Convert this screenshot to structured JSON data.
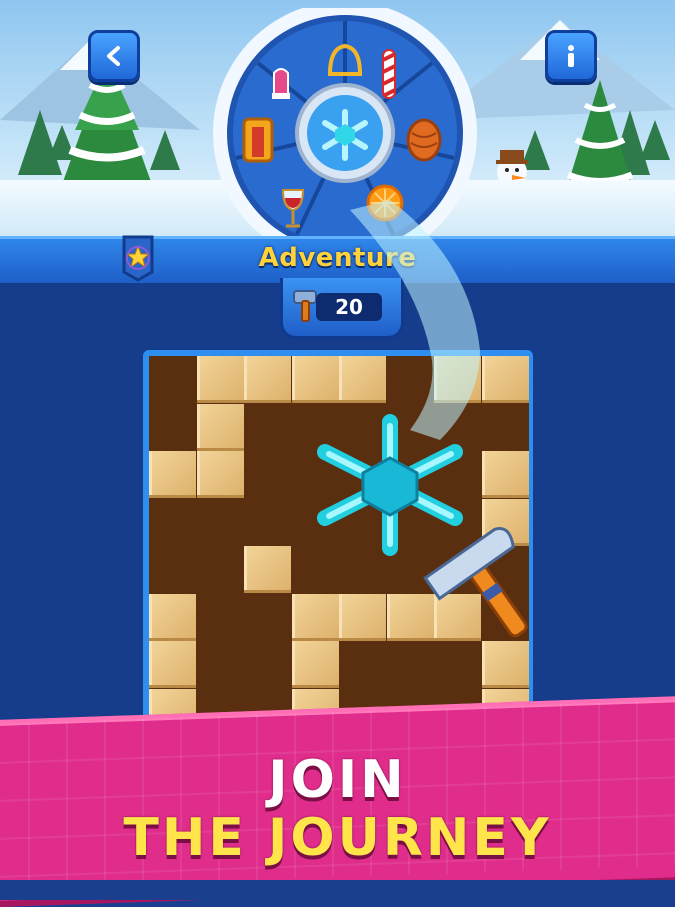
{
  "header": {
    "title": "Adventure",
    "back_icon": "chevron-left-icon",
    "info_icon": "info-icon",
    "badge_icon": "star-badge-icon"
  },
  "counter": {
    "icon": "hammer-icon",
    "value": "20"
  },
  "wheel": {
    "center_icon": "snowflake-icon",
    "items": [
      "bell-icon",
      "candy-cane-icon",
      "pinecone-icon",
      "orange-slice-icon",
      "wine-glass-icon",
      "scarf-icon",
      "mitten-icon"
    ]
  },
  "board": {
    "featured_icon": "snowflake-icon",
    "tool_icon": "hammer-icon"
  },
  "banner": {
    "line1": "JOIN",
    "line2": "THE JOURNEY"
  },
  "colors": {
    "header_blue": "#1e5fc8",
    "title_yellow": "#ffd23a",
    "banner_pink": "#e02d8c",
    "board_brown": "#5a2f10",
    "block_tan": "#dcb06a"
  }
}
